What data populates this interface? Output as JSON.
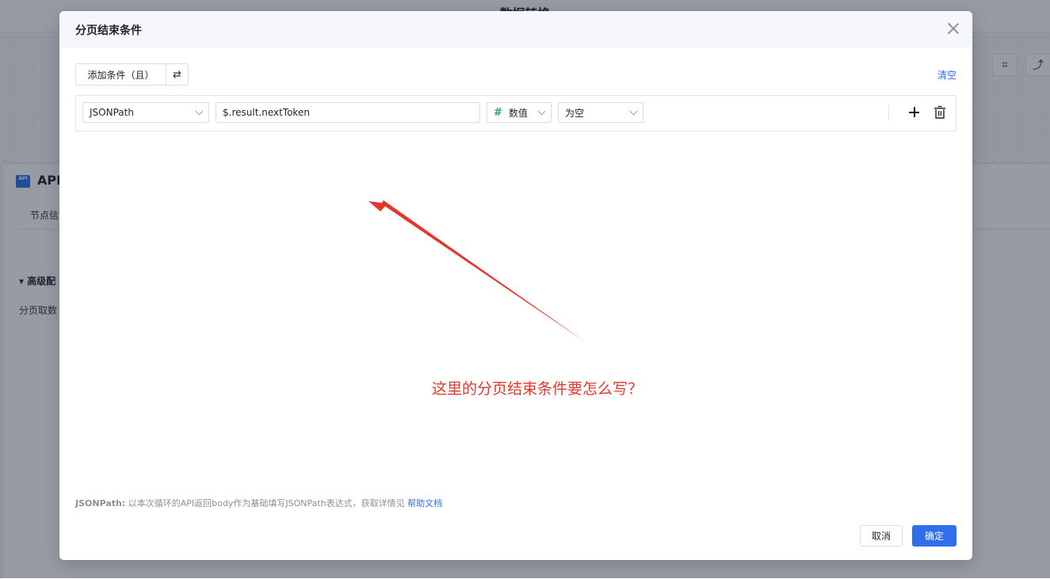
{
  "background": {
    "page_title": "数据转换",
    "node_title": "API",
    "node_icon_text": "API",
    "tab_label": "节点信",
    "section_label": "高级配",
    "field_label": "分页取数"
  },
  "modal": {
    "title": "分页结束条件",
    "add_condition_label": "添加条件（且）",
    "swap_label": "⇄",
    "clear_label": "清空",
    "condition": {
      "type": "JSONPath",
      "path_value": "$.result.nextToken",
      "value_type": "数值",
      "operator": "为空"
    },
    "hint_prefix": "JSONPath:",
    "hint_text": " 以本次循环的API返回body作为基础填写JSONPath表达式，获取详情见 ",
    "help_link": "帮助文档",
    "cancel_label": "取消",
    "ok_label": "确定"
  },
  "annotation": {
    "text": "这里的分页结束条件要怎么写？",
    "color": "#e4372c"
  },
  "colors": {
    "primary": "#2f6fec",
    "annotation": "#e4372c"
  }
}
